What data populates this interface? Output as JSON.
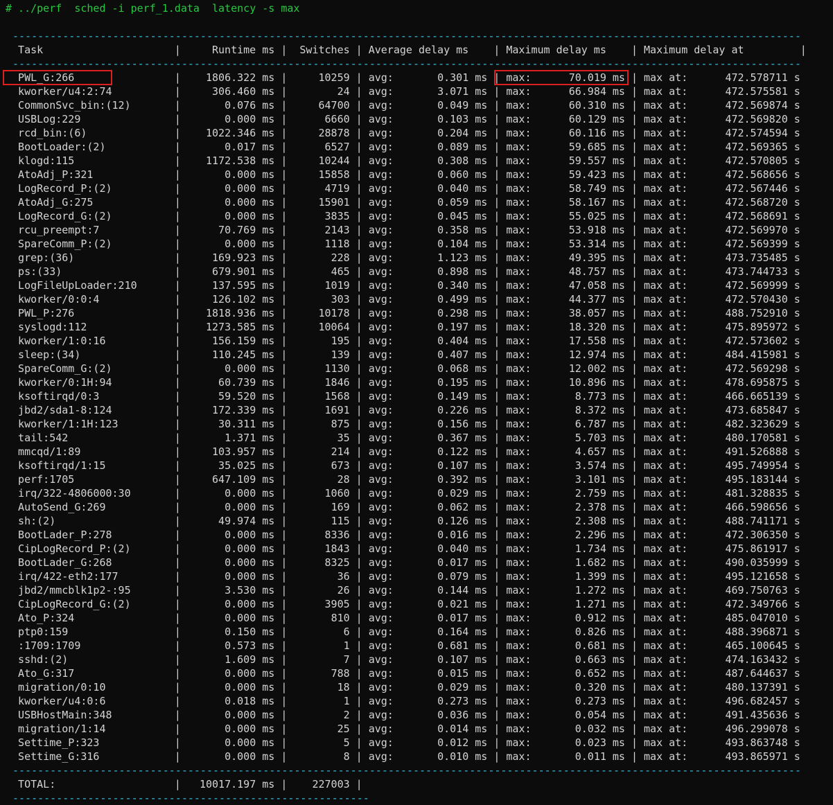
{
  "terminal": {
    "command": "# ../perf  sched -i perf_1.data  latency -s max"
  },
  "colors": {
    "background": "#0c0c0c",
    "text": "#d4d4d4",
    "command": "#27c93f",
    "separator": "#38bdde",
    "highlight": "#de1f1f"
  },
  "annotations": {
    "highlighted_row_index": 0
  },
  "table": {
    "headers": {
      "task": "Task",
      "runtime": "Runtime ms",
      "switches": "Switches",
      "avg": "Average delay ms",
      "max": "Maximum delay ms",
      "max_at": "Maximum delay at"
    },
    "labels": {
      "avg": "avg:",
      "max": "max:",
      "max_at": "max at:",
      "unit_ms": "ms",
      "unit_s": "s"
    },
    "rows": [
      {
        "task": "PWL_G:266",
        "runtime": "1806.322",
        "switches": "10259",
        "avg": "0.301",
        "max": "70.019",
        "max_at": "472.578711"
      },
      {
        "task": "kworker/u4:2:74",
        "runtime": "306.460",
        "switches": "24",
        "avg": "3.071",
        "max": "66.984",
        "max_at": "472.575581"
      },
      {
        "task": "CommonSvc_bin:(12)",
        "runtime": "0.076",
        "switches": "64700",
        "avg": "0.049",
        "max": "60.310",
        "max_at": "472.569874"
      },
      {
        "task": "USBLog:229",
        "runtime": "0.000",
        "switches": "6660",
        "avg": "0.103",
        "max": "60.129",
        "max_at": "472.569820"
      },
      {
        "task": "rcd_bin:(6)",
        "runtime": "1022.346",
        "switches": "28878",
        "avg": "0.204",
        "max": "60.116",
        "max_at": "472.574594"
      },
      {
        "task": "BootLoader:(2)",
        "runtime": "0.017",
        "switches": "6527",
        "avg": "0.089",
        "max": "59.685",
        "max_at": "472.569365"
      },
      {
        "task": "klogd:115",
        "runtime": "1172.538",
        "switches": "10244",
        "avg": "0.308",
        "max": "59.557",
        "max_at": "472.570805"
      },
      {
        "task": "AtoAdj_P:321",
        "runtime": "0.000",
        "switches": "15858",
        "avg": "0.060",
        "max": "59.423",
        "max_at": "472.568656"
      },
      {
        "task": "LogRecord_P:(2)",
        "runtime": "0.000",
        "switches": "4719",
        "avg": "0.040",
        "max": "58.749",
        "max_at": "472.567446"
      },
      {
        "task": "AtoAdj_G:275",
        "runtime": "0.000",
        "switches": "15901",
        "avg": "0.059",
        "max": "58.167",
        "max_at": "472.568720"
      },
      {
        "task": "LogRecord_G:(2)",
        "runtime": "0.000",
        "switches": "3835",
        "avg": "0.045",
        "max": "55.025",
        "max_at": "472.568691"
      },
      {
        "task": "rcu_preempt:7",
        "runtime": "70.769",
        "switches": "2143",
        "avg": "0.358",
        "max": "53.918",
        "max_at": "472.569970"
      },
      {
        "task": "SpareComm_P:(2)",
        "runtime": "0.000",
        "switches": "1118",
        "avg": "0.104",
        "max": "53.314",
        "max_at": "472.569399"
      },
      {
        "task": "grep:(36)",
        "runtime": "169.923",
        "switches": "228",
        "avg": "1.123",
        "max": "49.395",
        "max_at": "473.735485"
      },
      {
        "task": "ps:(33)",
        "runtime": "679.901",
        "switches": "465",
        "avg": "0.898",
        "max": "48.757",
        "max_at": "473.744733"
      },
      {
        "task": "LogFileUpLoader:210",
        "runtime": "137.595",
        "switches": "1019",
        "avg": "0.340",
        "max": "47.058",
        "max_at": "472.569999"
      },
      {
        "task": "kworker/0:0:4",
        "runtime": "126.102",
        "switches": "303",
        "avg": "0.499",
        "max": "44.377",
        "max_at": "472.570430"
      },
      {
        "task": "PWL_P:276",
        "runtime": "1818.936",
        "switches": "10178",
        "avg": "0.298",
        "max": "38.057",
        "max_at": "488.752910"
      },
      {
        "task": "syslogd:112",
        "runtime": "1273.585",
        "switches": "10064",
        "avg": "0.197",
        "max": "18.320",
        "max_at": "475.895972"
      },
      {
        "task": "kworker/1:0:16",
        "runtime": "156.159",
        "switches": "195",
        "avg": "0.404",
        "max": "17.558",
        "max_at": "472.573602"
      },
      {
        "task": "sleep:(34)",
        "runtime": "110.245",
        "switches": "139",
        "avg": "0.407",
        "max": "12.974",
        "max_at": "484.415981"
      },
      {
        "task": "SpareComm_G:(2)",
        "runtime": "0.000",
        "switches": "1130",
        "avg": "0.068",
        "max": "12.002",
        "max_at": "472.569298"
      },
      {
        "task": "kworker/0:1H:94",
        "runtime": "60.739",
        "switches": "1846",
        "avg": "0.195",
        "max": "10.896",
        "max_at": "478.695875"
      },
      {
        "task": "ksoftirqd/0:3",
        "runtime": "59.520",
        "switches": "1568",
        "avg": "0.149",
        "max": "8.773",
        "max_at": "466.665139"
      },
      {
        "task": "jbd2/sda1-8:124",
        "runtime": "172.339",
        "switches": "1691",
        "avg": "0.226",
        "max": "8.372",
        "max_at": "473.685847"
      },
      {
        "task": "kworker/1:1H:123",
        "runtime": "30.311",
        "switches": "875",
        "avg": "0.156",
        "max": "6.787",
        "max_at": "482.323629"
      },
      {
        "task": "tail:542",
        "runtime": "1.371",
        "switches": "35",
        "avg": "0.367",
        "max": "5.703",
        "max_at": "480.170581"
      },
      {
        "task": "mmcqd/1:89",
        "runtime": "103.957",
        "switches": "214",
        "avg": "0.122",
        "max": "4.657",
        "max_at": "491.526888"
      },
      {
        "task": "ksoftirqd/1:15",
        "runtime": "35.025",
        "switches": "673",
        "avg": "0.107",
        "max": "3.574",
        "max_at": "495.749954"
      },
      {
        "task": "perf:1705",
        "runtime": "647.109",
        "switches": "28",
        "avg": "0.392",
        "max": "3.101",
        "max_at": "495.183144"
      },
      {
        "task": "irq/322-4806000:30",
        "runtime": "0.000",
        "switches": "1060",
        "avg": "0.029",
        "max": "2.759",
        "max_at": "481.328835"
      },
      {
        "task": "AutoSend_G:269",
        "runtime": "0.000",
        "switches": "169",
        "avg": "0.062",
        "max": "2.378",
        "max_at": "466.598656"
      },
      {
        "task": "sh:(2)",
        "runtime": "49.974",
        "switches": "115",
        "avg": "0.126",
        "max": "2.308",
        "max_at": "488.741171"
      },
      {
        "task": "BootLader_P:278",
        "runtime": "0.000",
        "switches": "8336",
        "avg": "0.016",
        "max": "2.296",
        "max_at": "472.306350"
      },
      {
        "task": "CipLogRecord_P:(2)",
        "runtime": "0.000",
        "switches": "1843",
        "avg": "0.040",
        "max": "1.734",
        "max_at": "475.861917"
      },
      {
        "task": "BootLader_G:268",
        "runtime": "0.000",
        "switches": "8325",
        "avg": "0.017",
        "max": "1.682",
        "max_at": "490.035999"
      },
      {
        "task": "irq/422-eth2:177",
        "runtime": "0.000",
        "switches": "36",
        "avg": "0.079",
        "max": "1.399",
        "max_at": "495.121658"
      },
      {
        "task": "jbd2/mmcblk1p2-:95",
        "runtime": "3.530",
        "switches": "26",
        "avg": "0.144",
        "max": "1.272",
        "max_at": "469.750763"
      },
      {
        "task": "CipLogRecord_G:(2)",
        "runtime": "0.000",
        "switches": "3905",
        "avg": "0.021",
        "max": "1.271",
        "max_at": "472.349766"
      },
      {
        "task": "Ato_P:324",
        "runtime": "0.000",
        "switches": "810",
        "avg": "0.017",
        "max": "0.912",
        "max_at": "485.047010"
      },
      {
        "task": "ptp0:159",
        "runtime": "0.150",
        "switches": "6",
        "avg": "0.164",
        "max": "0.826",
        "max_at": "488.396871"
      },
      {
        "task": ":1709:1709",
        "runtime": "0.573",
        "switches": "1",
        "avg": "0.681",
        "max": "0.681",
        "max_at": "465.100645"
      },
      {
        "task": "sshd:(2)",
        "runtime": "1.609",
        "switches": "7",
        "avg": "0.107",
        "max": "0.663",
        "max_at": "474.163432"
      },
      {
        "task": "Ato_G:317",
        "runtime": "0.000",
        "switches": "788",
        "avg": "0.015",
        "max": "0.652",
        "max_at": "487.644637"
      },
      {
        "task": "migration/0:10",
        "runtime": "0.000",
        "switches": "18",
        "avg": "0.029",
        "max": "0.320",
        "max_at": "480.137391"
      },
      {
        "task": "kworker/u4:0:6",
        "runtime": "0.018",
        "switches": "1",
        "avg": "0.273",
        "max": "0.273",
        "max_at": "496.682457"
      },
      {
        "task": "USBHostMain:348",
        "runtime": "0.000",
        "switches": "2",
        "avg": "0.036",
        "max": "0.054",
        "max_at": "491.435636"
      },
      {
        "task": "migration/1:14",
        "runtime": "0.000",
        "switches": "25",
        "avg": "0.014",
        "max": "0.032",
        "max_at": "496.299078"
      },
      {
        "task": "Settime_P:323",
        "runtime": "0.000",
        "switches": "5",
        "avg": "0.012",
        "max": "0.023",
        "max_at": "493.863748"
      },
      {
        "task": "Settime_G:316",
        "runtime": "0.000",
        "switches": "8",
        "avg": "0.010",
        "max": "0.011",
        "max_at": "493.865971"
      }
    ],
    "total": {
      "label": "TOTAL:",
      "runtime": "10017.197",
      "switches": "227003"
    }
  }
}
